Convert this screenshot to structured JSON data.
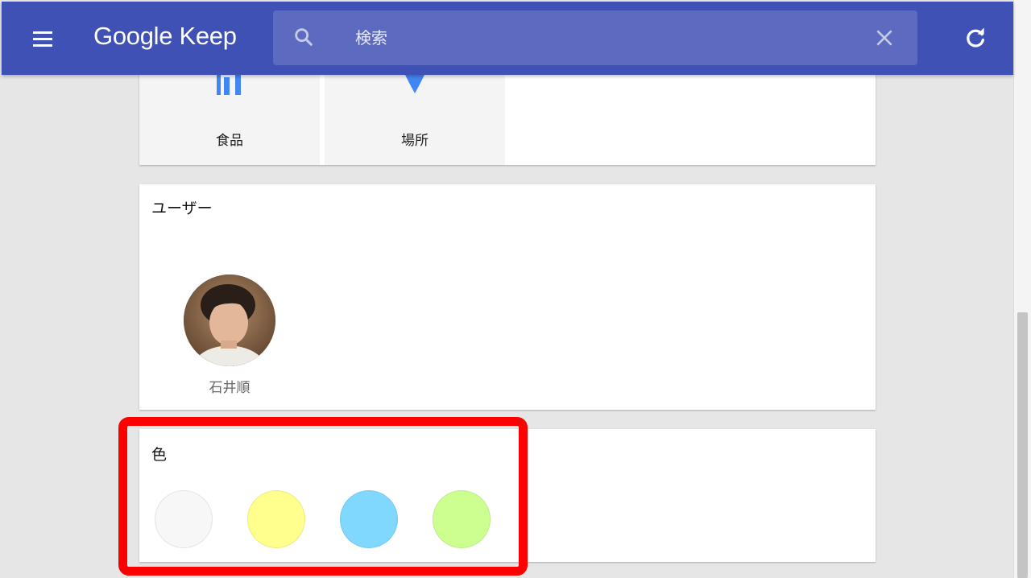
{
  "app": {
    "title": "Google Keep",
    "icons": {
      "menu": "menu-icon",
      "search": "search-icon",
      "clear": "close-icon",
      "refresh": "refresh-icon"
    },
    "colors": {
      "appbar": "#3f51b5",
      "search_bg": "#5c6bc0"
    }
  },
  "search": {
    "placeholder": "検索",
    "value": ""
  },
  "things": {
    "tiles": [
      {
        "label": "食品",
        "icon": "restaurant-icon",
        "color": "#4285f4"
      },
      {
        "label": "場所",
        "icon": "place-pin-icon",
        "color": "#4285f4"
      }
    ]
  },
  "users": {
    "title": "ユーザー",
    "items": [
      {
        "name": "石井順",
        "avatar": "user-avatar-photo"
      }
    ]
  },
  "colors": {
    "title": "色",
    "swatches": [
      {
        "name": "white",
        "hex": "#f7f7f7"
      },
      {
        "name": "yellow",
        "hex": "#ffff8d"
      },
      {
        "name": "blue",
        "hex": "#80d8ff"
      },
      {
        "name": "green",
        "hex": "#ccff90"
      }
    ],
    "highlight_color": "#ff0000"
  }
}
